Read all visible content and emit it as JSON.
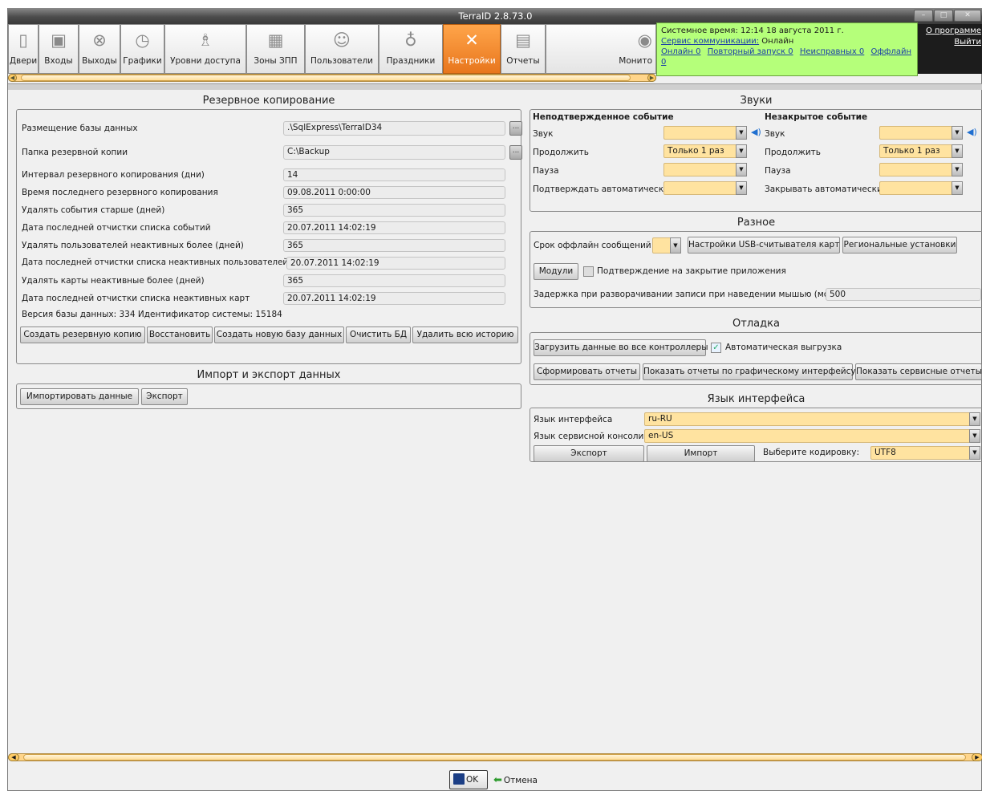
{
  "window": {
    "title": "TerraID 2.8.73.0",
    "minimize": "–",
    "maximize": "□",
    "close": "✕"
  },
  "toolbar": [
    {
      "label": "Двери",
      "icon": "door-icon",
      "glyph": "▯"
    },
    {
      "label": "Входы",
      "icon": "entry-icon",
      "glyph": "▣"
    },
    {
      "label": "Выходы",
      "icon": "exit-icon",
      "glyph": "⊗"
    },
    {
      "label": "Графики",
      "icon": "clock-icon",
      "glyph": "◷"
    },
    {
      "label": "Уровни доступа",
      "icon": "access-levels-icon",
      "glyph": "♗"
    },
    {
      "label": "Зоны ЗПП",
      "icon": "zones-icon",
      "glyph": "▦"
    },
    {
      "label": "Пользователи",
      "icon": "users-icon",
      "glyph": "☺"
    },
    {
      "label": "Праздники",
      "icon": "balloons-icon",
      "glyph": "♁"
    },
    {
      "label": "Настройки",
      "icon": "tools-icon",
      "glyph": "✕"
    },
    {
      "label": "Отчеты",
      "icon": "reports-icon",
      "glyph": "▤"
    },
    {
      "label": "Монито",
      "icon": "monitor-eye-icon",
      "glyph": "◉"
    }
  ],
  "status": {
    "system_time": "Системное время: 12:14 18 августа 2011 г.",
    "service_link": "Сервис коммуникации:",
    "service_state": " Онлайн",
    "online": "Онлайн 0",
    "restart": "Повторный запуск 0",
    "faulty": "Неисправных 0",
    "offline": "Оффлайн 0",
    "color": "#b5ff7a"
  },
  "toplinks": {
    "about": "О программе",
    "logout": "Выйти"
  },
  "backup": {
    "title": "Резервное копирование",
    "rows": [
      {
        "label": "Размещение базы данных",
        "value": ".\\SqlExpress\\TerraID34",
        "browse": "..."
      },
      {
        "label": "Папка резервной копии",
        "value": "C:\\Backup",
        "browse": "..."
      },
      {
        "label": "Интервал резервного копирования (дни)",
        "value": "14"
      },
      {
        "label": "Время последнего резервного копирования",
        "value": "09.08.2011 0:00:00"
      },
      {
        "label": "Удалять события старше (дней)",
        "value": "365"
      },
      {
        "label": "Дата последней отчистки списка событий",
        "value": "20.07.2011 14:02:19"
      },
      {
        "label": "Удалять пользователей неактивных более (дней)",
        "value": "365"
      },
      {
        "label": "Дата последней отчистки списка неактивных пользователей",
        "value": "20.07.2011 14:02:19"
      },
      {
        "label": "Удалять карты неактивные более (дней)",
        "value": "365"
      },
      {
        "label": "Дата последней отчистки списка неактивных карт",
        "value": "20.07.2011 14:02:19"
      }
    ],
    "db_info": "Версия базы данных: 334   Идентификатор системы: 15184",
    "buttons": [
      "Создать резервную копию",
      "Восстановить",
      "Создать новую базу данных",
      "Очистить БД",
      "Удалить всю историю"
    ]
  },
  "import_export": {
    "title": "Импорт и экспорт данных",
    "import_btn": "Импортировать данные",
    "export_btn": "Экспорт"
  },
  "sounds": {
    "title": "Звуки",
    "unconfirmed_title": "Неподтвержденное событие",
    "unclosed_title": "Незакрытое событие",
    "sound": "Звук",
    "continue": "Продолжить",
    "continue_value": "Только 1 раз",
    "pause": "Пауза",
    "confirm_auto": "Подтверждать автоматически",
    "close_auto": "Закрывать автоматически"
  },
  "misc": {
    "title": "Разное",
    "offline_msgs": "Срок оффлайн сообщений",
    "usb_btn": "Настройки USB-считывателя карт",
    "regional_btn": "Региональные установки",
    "modules_btn": "Модули",
    "confirm_close": "Подтверждение на закрытие приложения",
    "delay_label": "Задержка при разворачивании записи при наведении мышью (мс)",
    "delay_value": "500"
  },
  "debug": {
    "title": "Отладка",
    "load_btn": "Загрузить данные во все контроллеры",
    "auto_upload": "Автоматическая выгрузка",
    "make_reports": "Сформировать отчеты",
    "show_gui_reports": "Показать отчеты по графическому интерфейсу",
    "show_service_reports": "Показать сервисные отчеты"
  },
  "language": {
    "title": "Язык интерфейса",
    "ui_lang_label": "Язык интерфейса",
    "ui_lang_value": "ru-RU",
    "console_lang_label": "Язык сервисной консоли",
    "console_lang_value": "en-US",
    "export_btn": "Экспорт",
    "import_btn": "Импорт",
    "encoding_label": "Выберите кодировку:",
    "encoding_value": "UTF8"
  },
  "footer": {
    "ok": "OK",
    "cancel": "Отмена"
  },
  "colors": {
    "accent": "#f08a2a",
    "field_yellow": "#ffe3a0"
  }
}
